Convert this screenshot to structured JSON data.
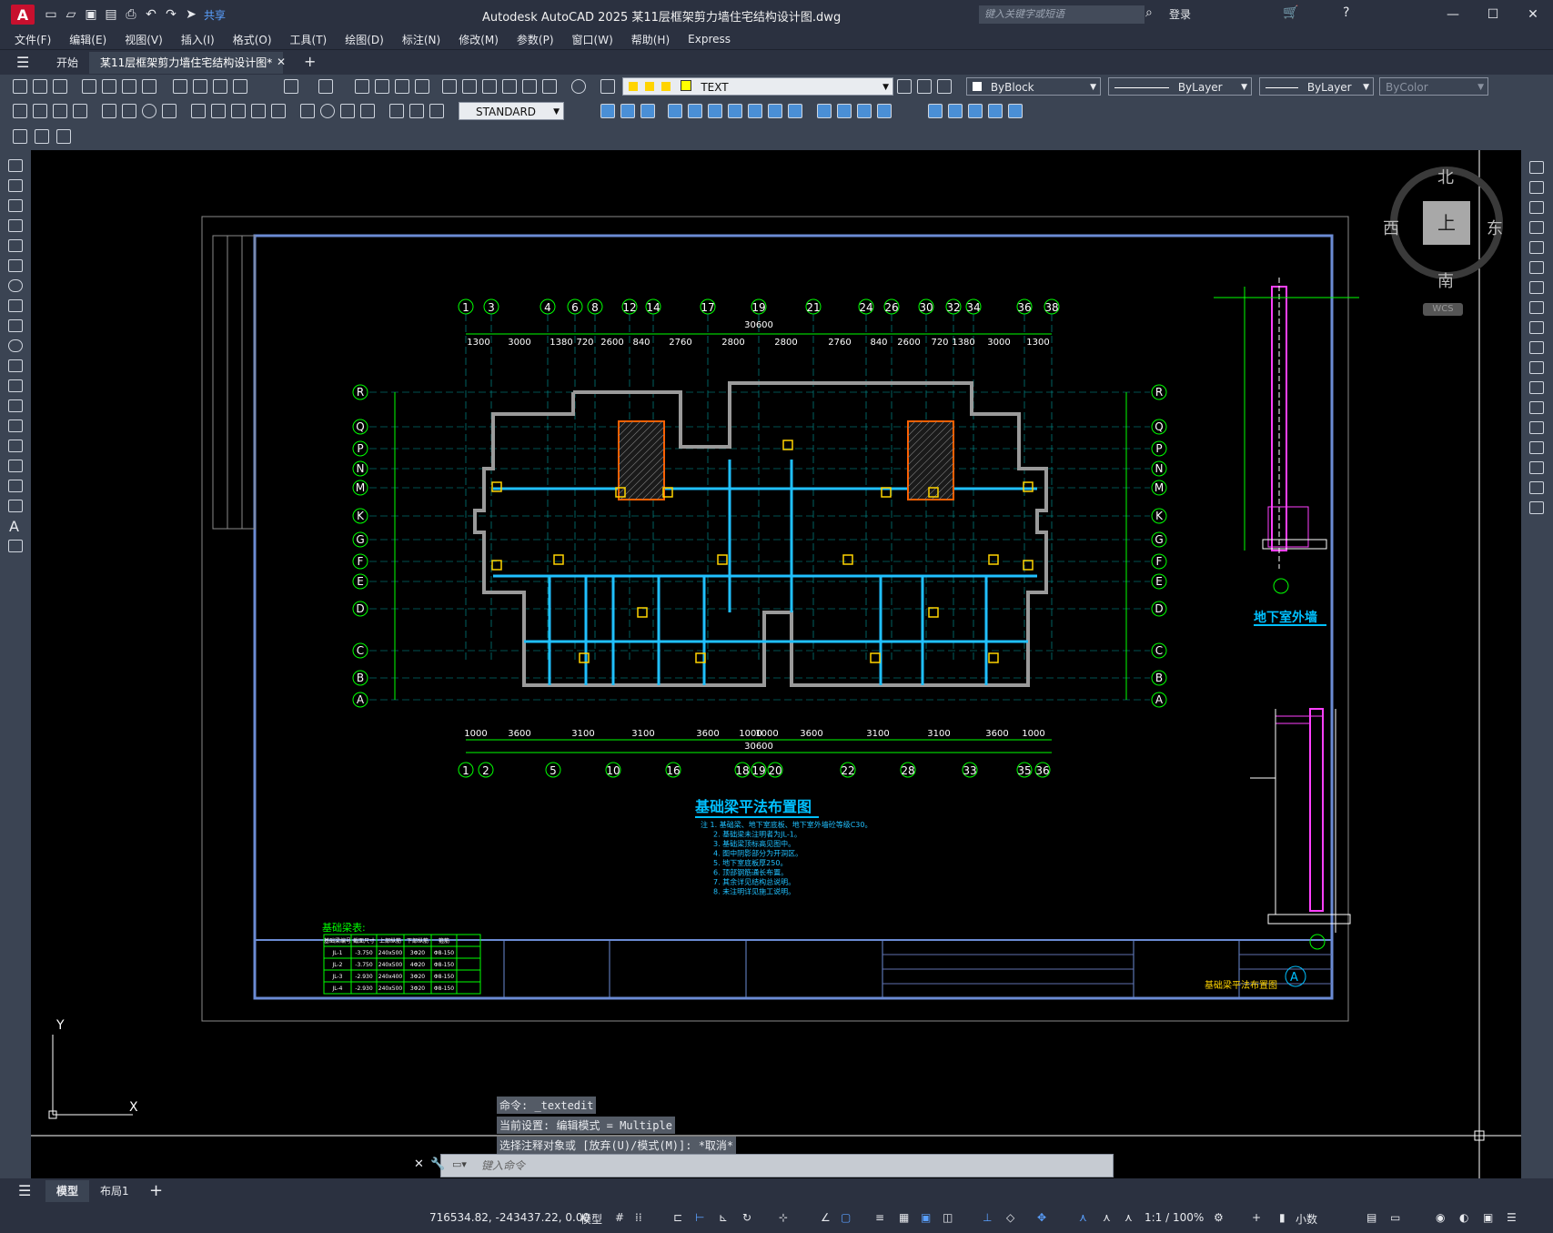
{
  "window": {
    "title": "Autodesk AutoCAD 2025    某11层框架剪力墙住宅结构设计图.dwg",
    "share": "共享",
    "search_placeholder": "键入关键字或短语",
    "login": "登录"
  },
  "menu": [
    "文件(F)",
    "编辑(E)",
    "视图(V)",
    "插入(I)",
    "格式(O)",
    "工具(T)",
    "绘图(D)",
    "标注(N)",
    "修改(M)",
    "参数(P)",
    "窗口(W)",
    "帮助(H)",
    "Express"
  ],
  "tabs": {
    "home": "开始",
    "doc": "某11层框架剪力墙住宅结构设计图*"
  },
  "props": {
    "layer": "TEXT",
    "color": "ByBlock",
    "linetype": "ByLayer",
    "lineweight": "ByLayer",
    "plotstyle": "ByColor",
    "textstyle": "STANDARD"
  },
  "viewcube": {
    "n": "北",
    "s": "南",
    "w": "西",
    "e": "东",
    "top": "上",
    "wcs": "WCS"
  },
  "drawing": {
    "top_axes": [
      "1",
      "3",
      "4",
      "6",
      "8",
      "12",
      "14",
      "17",
      "19",
      "21",
      "24",
      "26",
      "30",
      "32",
      "34",
      "36",
      "38"
    ],
    "top_dims": [
      "1300",
      "3000",
      "1380",
      "720",
      "2600",
      "840",
      "2760",
      "2800",
      "2800",
      "2760",
      "840",
      "2600",
      "720",
      "1380",
      "3000",
      "1300"
    ],
    "bottom_axes": [
      "1",
      "2",
      "5",
      "10",
      "16",
      "18",
      "19",
      "20",
      "22",
      "28",
      "33",
      "35",
      "36"
    ],
    "bottom_dims": [
      "1000",
      "3600",
      "3100",
      "3100",
      "3600",
      "1000",
      "1000",
      "3600",
      "3100",
      "3100",
      "3600",
      "1000"
    ],
    "total_dim": "30600",
    "row_axes": [
      "R",
      "Q",
      "P",
      "N",
      "M",
      "K",
      "G",
      "F",
      "E",
      "D",
      "C",
      "B",
      "A"
    ],
    "plan_title": "基础梁平法布置图",
    "section1_title": "地下室外墙",
    "section2_axis": "A",
    "table_title": "基础梁表:",
    "table_headers": [
      "基础梁编号",
      "截面尺寸",
      "上部纵筋",
      "下部纵筋",
      "箍筋"
    ],
    "table_rows": [
      [
        "JL-1",
        "-3.750",
        "240x500",
        "3Φ20",
        "Φ8-150"
      ],
      [
        "JL-2",
        "-3.750",
        "240x500",
        "4Φ20",
        "Φ8-150"
      ],
      [
        "JL-3",
        "-2.930",
        "240x400",
        "3Φ20",
        "Φ8-150"
      ],
      [
        "JL-4",
        "-2.930",
        "240x500",
        "3Φ20",
        "Φ8-150"
      ]
    ],
    "notes": [
      "注 1. 基础梁、地下室底板、地下室外墙砼等级C30。",
      "2. 基础梁未注明者为JL-1。",
      "3. 基础梁顶标高见图中。",
      "4. 图中阴影部分为开洞区。",
      "5. 地下室底板厚250。",
      "6. 顶部钢筋通长布置。",
      "7. 其余详见结构总说明。",
      "8. 未注明详见施工说明。"
    ],
    "titleblock": {
      "drawing_name": "基础梁平法布置图"
    }
  },
  "command": {
    "line1": "命令: _textedit",
    "line2": "当前设置: 编辑模式 = Multiple",
    "line3": "选择注释对象或 [放弃(U)/模式(M)]: *取消*",
    "placeholder": "键入命令"
  },
  "layouts": {
    "model": "模型",
    "layout1": "布局1"
  },
  "status": {
    "coords": "716534.82, -243437.22, 0.00",
    "model": "模型",
    "scale": "1:1 / 100%",
    "units": "小数"
  }
}
